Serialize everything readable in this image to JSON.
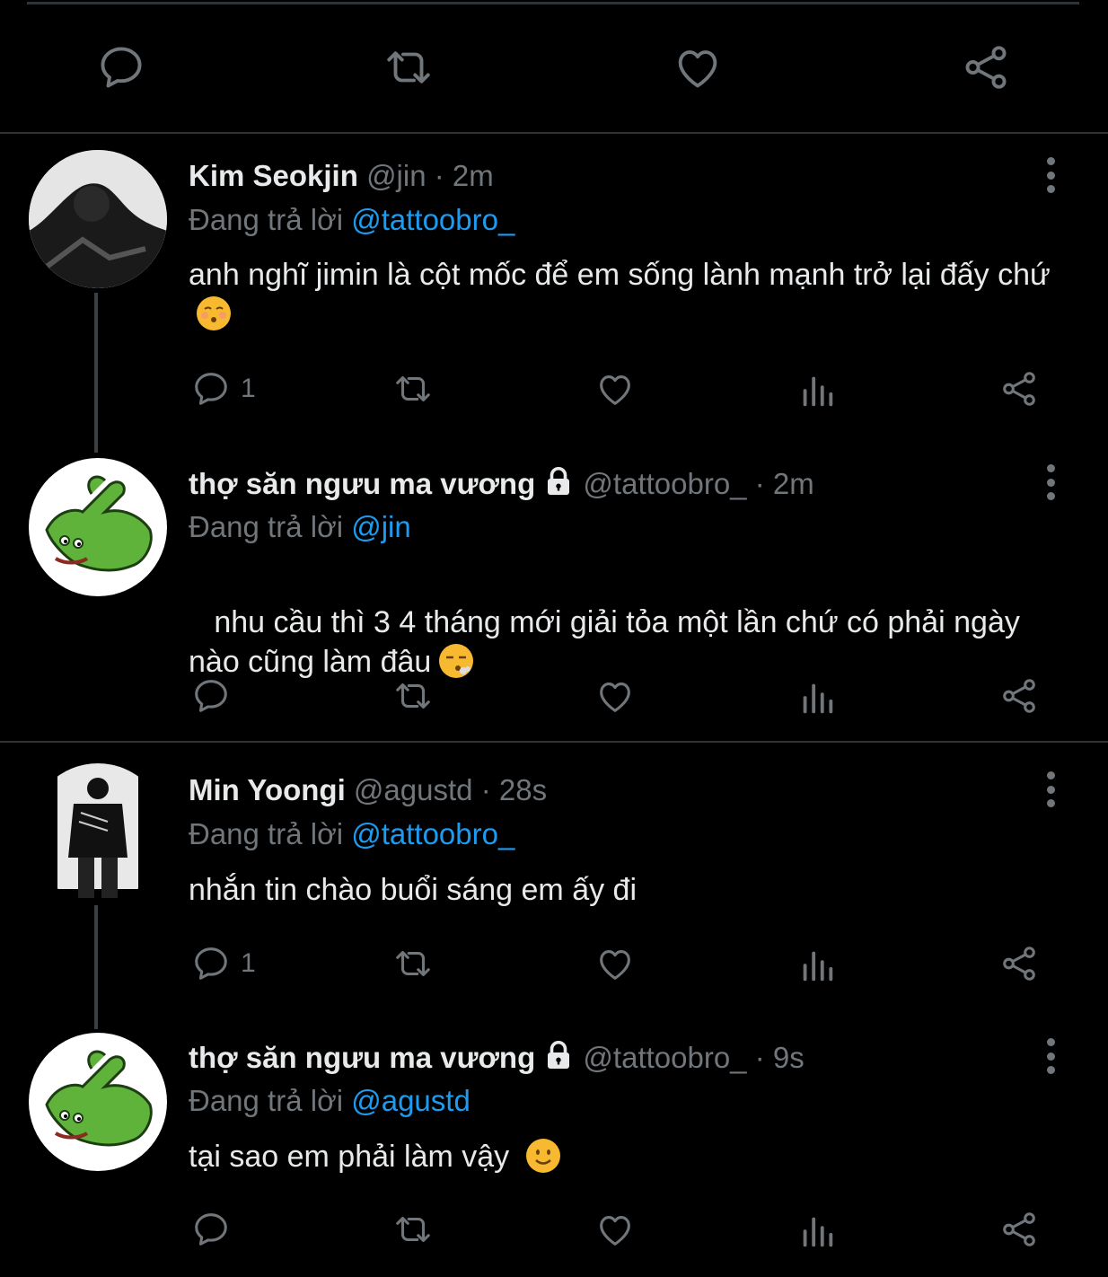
{
  "colors": {
    "background": "#000000",
    "text": "#e7e9ea",
    "muted": "#71767b",
    "accent": "#1d9bf0",
    "divider": "#2f3336"
  },
  "top_actions": [
    {
      "icon": "reply-icon"
    },
    {
      "icon": "retweet-icon"
    },
    {
      "icon": "like-icon"
    },
    {
      "icon": "share-icon"
    }
  ],
  "replies": [
    {
      "name": "Kim Seokjin",
      "handle": "@jin",
      "separator": "·",
      "time": "2m",
      "reply_prefix": "Đang trả lời",
      "reply_to": "@tattoobro_",
      "text": "anh nghĩ jimin là cột mốc để em sống lành mạnh trở lại đấy chứ",
      "emoji": "kissing-face-icon",
      "reply_count": "1"
    },
    {
      "name": "thợ săn ngưu ma vương",
      "locked": true,
      "handle": "@tattoobro_",
      "separator": "·",
      "time": "2m",
      "reply_prefix": "Đang trả lời",
      "reply_to": "@jin",
      "text": " nhu cầu thì 3 4 tháng mới giải tỏa một lần chứ có phải ngày nào cũng làm đâu",
      "emoji": "face-exhaling-icon",
      "reply_count": ""
    },
    {
      "name": "Min Yoongi",
      "handle": "@agustd",
      "separator": "·",
      "time": "28s",
      "reply_prefix": "Đang trả lời",
      "reply_to": "@tattoobro_",
      "text": "nhắn tin chào buổi sáng em ấy đi",
      "emoji": "",
      "reply_count": "1"
    },
    {
      "name": "thợ săn ngưu ma vương",
      "locked": true,
      "handle": "@tattoobro_",
      "separator": "·",
      "time": "9s",
      "reply_prefix": "Đang trả lời",
      "reply_to": "@agustd",
      "text": "tại sao em phải làm vậy",
      "emoji": "slightly-smiling-face-icon",
      "reply_count": ""
    }
  ]
}
